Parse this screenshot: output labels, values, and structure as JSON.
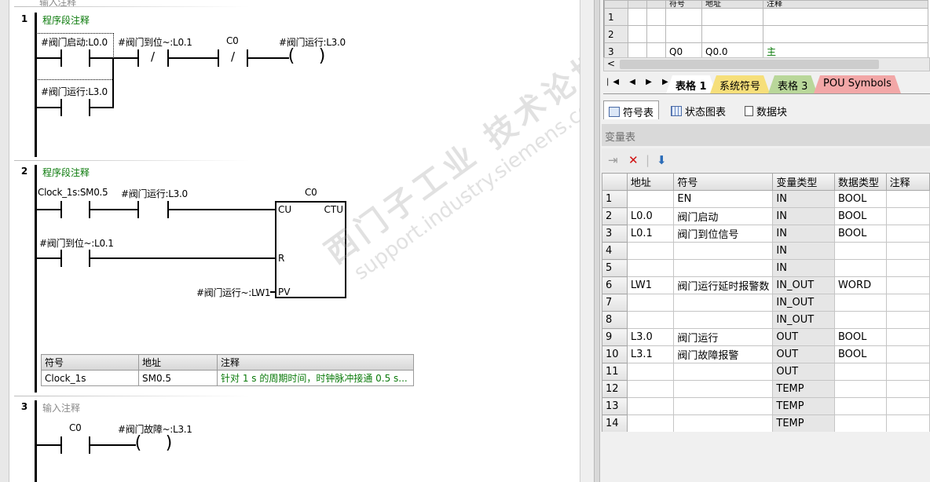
{
  "editor": {
    "top_hint": "输入注释",
    "networks": [
      {
        "num": "1",
        "comment": "程序段注释",
        "labels": {
          "c1": "#阀门启动:L0.0",
          "c2": "#阀门到位~:L0.1",
          "c3": "C0",
          "coil": "#阀门运行:L3.0",
          "c4": "#阀门运行:L3.0"
        }
      },
      {
        "num": "2",
        "comment": "程序段注释",
        "labels": {
          "c1": "Clock_1s:SM0.5",
          "c2": "#阀门运行:L3.0",
          "c3": "#阀门到位~:L0.1",
          "counter_name": "C0",
          "cu": "CU",
          "ctu": "CTU",
          "r": "R",
          "pv": "PV",
          "pv_operand": "#阀门运行~:LW1"
        },
        "symbol_table": {
          "headers": [
            "符号",
            "地址",
            "注释"
          ],
          "rows": [
            [
              "Clock_1s",
              "SM0.5",
              "针对 1 s 的周期时间，时钟脉冲接通 0.5 s..."
            ]
          ]
        }
      },
      {
        "num": "3",
        "comment": "输入注释",
        "labels": {
          "c1": "C0",
          "coil": "#阀门故障~:L3.1"
        }
      }
    ]
  },
  "symbol_grid": {
    "headers": [
      "符号",
      "地址",
      "注释"
    ],
    "rows": [
      {
        "n": "1",
        "sym": "",
        "addr": "",
        "cmt": ""
      },
      {
        "n": "2",
        "sym": "",
        "addr": "",
        "cmt": ""
      },
      {
        "n": "3",
        "sym": "Q0",
        "addr": "Q0.0",
        "cmt": "主"
      }
    ]
  },
  "sheet_tabs": [
    {
      "label": "表格 1",
      "color": "#ffffff"
    },
    {
      "label": "系统符号",
      "color": "#f6df7a"
    },
    {
      "label": "表格 3",
      "color": "#b9d79a"
    },
    {
      "label": "POU Symbols",
      "color": "#f2a7a7"
    }
  ],
  "view_tabs": [
    "符号表",
    "状态图表",
    "数据块"
  ],
  "var_table": {
    "title": "变量表",
    "headers": [
      "地址",
      "符号",
      "变量类型",
      "数据类型",
      "注释"
    ],
    "rows": [
      {
        "n": "1",
        "addr": "",
        "sym": "EN",
        "vtype": "IN",
        "dtype": "BOOL",
        "cmt": ""
      },
      {
        "n": "2",
        "addr": "L0.0",
        "sym": "阀门启动",
        "vtype": "IN",
        "dtype": "BOOL",
        "cmt": ""
      },
      {
        "n": "3",
        "addr": "L0.1",
        "sym": "阀门到位信号",
        "vtype": "IN",
        "dtype": "BOOL",
        "cmt": ""
      },
      {
        "n": "4",
        "addr": "",
        "sym": "",
        "vtype": "IN",
        "dtype": "",
        "cmt": ""
      },
      {
        "n": "5",
        "addr": "",
        "sym": "",
        "vtype": "IN",
        "dtype": "",
        "cmt": ""
      },
      {
        "n": "6",
        "addr": "LW1",
        "sym": "阀门运行延时报警数",
        "vtype": "IN_OUT",
        "dtype": "WORD",
        "cmt": ""
      },
      {
        "n": "7",
        "addr": "",
        "sym": "",
        "vtype": "IN_OUT",
        "dtype": "",
        "cmt": ""
      },
      {
        "n": "8",
        "addr": "",
        "sym": "",
        "vtype": "IN_OUT",
        "dtype": "",
        "cmt": ""
      },
      {
        "n": "9",
        "addr": "L3.0",
        "sym": "阀门运行",
        "vtype": "OUT",
        "dtype": "BOOL",
        "cmt": ""
      },
      {
        "n": "10",
        "addr": "L3.1",
        "sym": "阀门故障报警",
        "vtype": "OUT",
        "dtype": "BOOL",
        "cmt": ""
      },
      {
        "n": "11",
        "addr": "",
        "sym": "",
        "vtype": "OUT",
        "dtype": "",
        "cmt": ""
      },
      {
        "n": "12",
        "addr": "",
        "sym": "",
        "vtype": "TEMP",
        "dtype": "",
        "cmt": ""
      },
      {
        "n": "13",
        "addr": "",
        "sym": "",
        "vtype": "TEMP",
        "dtype": "",
        "cmt": ""
      },
      {
        "n": "14",
        "addr": "",
        "sym": "",
        "vtype": "TEMP",
        "dtype": "",
        "cmt": ""
      }
    ]
  },
  "watermark": {
    "line1": "西门子工业 技术论坛",
    "line2": "support.industry.siemens.com/cs"
  }
}
